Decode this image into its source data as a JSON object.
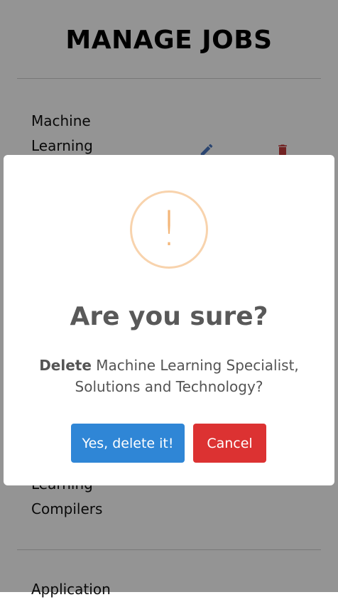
{
  "page": {
    "title": "MANAGE JOBS"
  },
  "jobs": [
    {
      "title": "Machine\nLearning"
    },
    {
      "title": "Learning\nCompilers"
    },
    {
      "title": "Application"
    }
  ],
  "dialog": {
    "icon": "warning-exclamation-icon",
    "icon_glyph": "!",
    "title": "Are you sure?",
    "message_bold": "Delete",
    "message_rest": " Machine Learning Specialist, Solutions and Technology?",
    "confirm_label": "Yes, delete it!",
    "cancel_label": "Cancel"
  },
  "colors": {
    "confirm": "#2f86d6",
    "cancel": "#dc3232",
    "warning": "#f3b679",
    "overlay": "rgba(0,0,0,0.42)"
  }
}
